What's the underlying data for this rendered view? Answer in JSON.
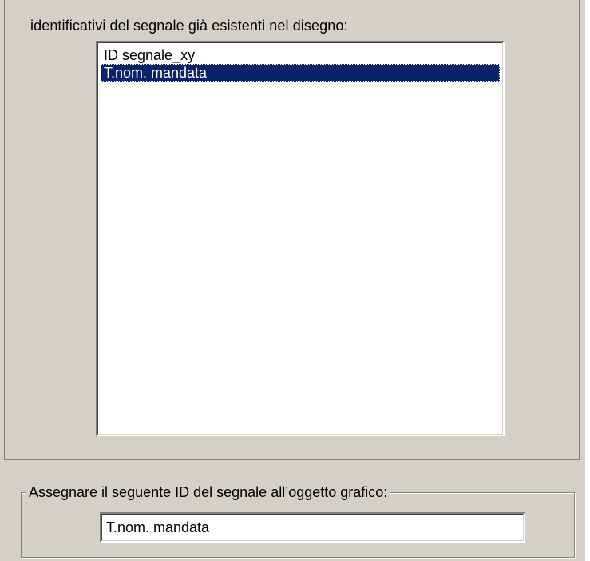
{
  "signal_list": {
    "description": "identificativi del segnale già esistenti nel disegno:",
    "items": [
      {
        "label": "ID segnale_xy",
        "selected": false
      },
      {
        "label": "T.nom. mandata",
        "selected": true
      }
    ]
  },
  "assign_group": {
    "legend": "Assegnare il seguente ID del segnale all’oggetto grafico:",
    "value": "T.nom. mandata"
  },
  "colors": {
    "dialog_background": "#d4d0c8",
    "selection_background": "#0a246a",
    "selection_text": "#ffffff"
  }
}
